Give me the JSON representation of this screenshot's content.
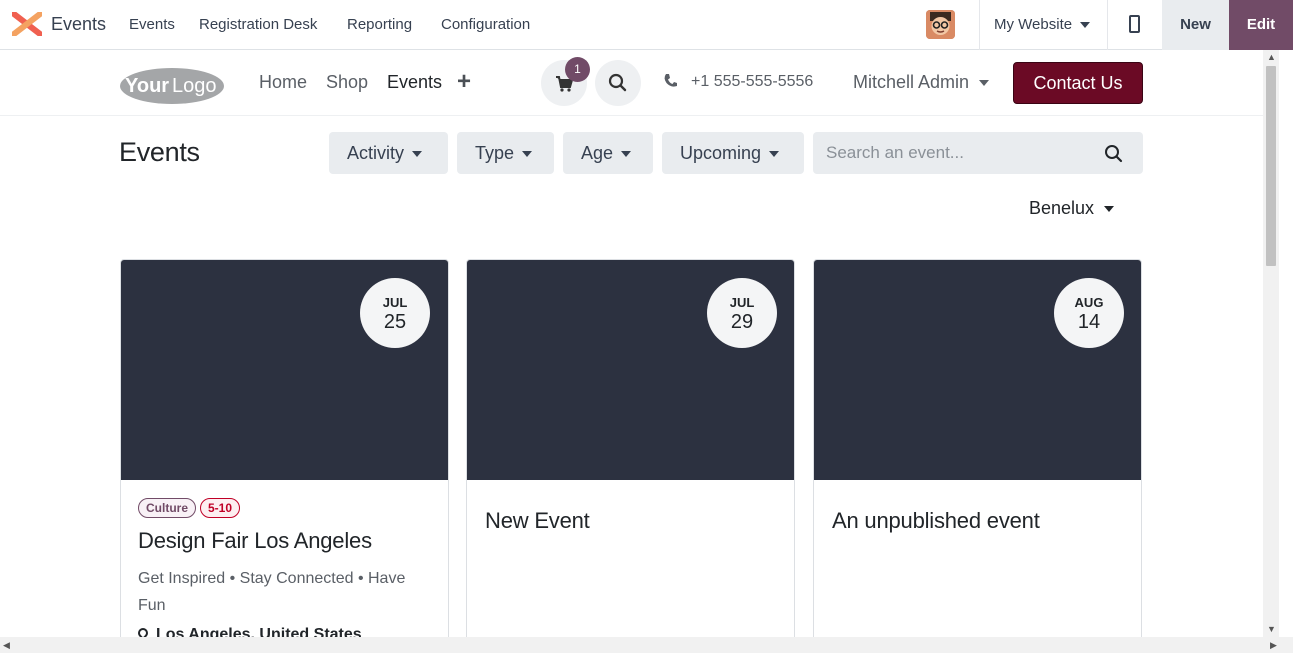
{
  "topbar": {
    "app_name": "Events",
    "menu": [
      "Events",
      "Registration Desk",
      "Reporting",
      "Configuration"
    ],
    "website_selector": "My Website",
    "new_label": "New",
    "edit_label": "Edit",
    "accent_color": "#714b67"
  },
  "site_header": {
    "logo_text": "YourLogo",
    "nav": [
      "Home",
      "Shop",
      "Events"
    ],
    "active_nav": "Events",
    "cart_count": "1",
    "phone": "+1 555-555-5556",
    "user": "Mitchell Admin",
    "cta": "Contact Us"
  },
  "page": {
    "title": "Events",
    "filters": [
      "Activity",
      "Type",
      "Age",
      "Upcoming"
    ],
    "search_placeholder": "Search an event...",
    "region": "Benelux"
  },
  "events": [
    {
      "month": "JUL",
      "day": "25",
      "tags": [
        "Culture",
        "5-10"
      ],
      "title": "Design Fair Los Angeles",
      "subtitle": "Get Inspired • Stay Connected • Have Fun",
      "location": "Los Angeles, United States"
    },
    {
      "month": "JUL",
      "day": "29",
      "title": "New Event"
    },
    {
      "month": "AUG",
      "day": "14",
      "title": "An unpublished event"
    }
  ]
}
